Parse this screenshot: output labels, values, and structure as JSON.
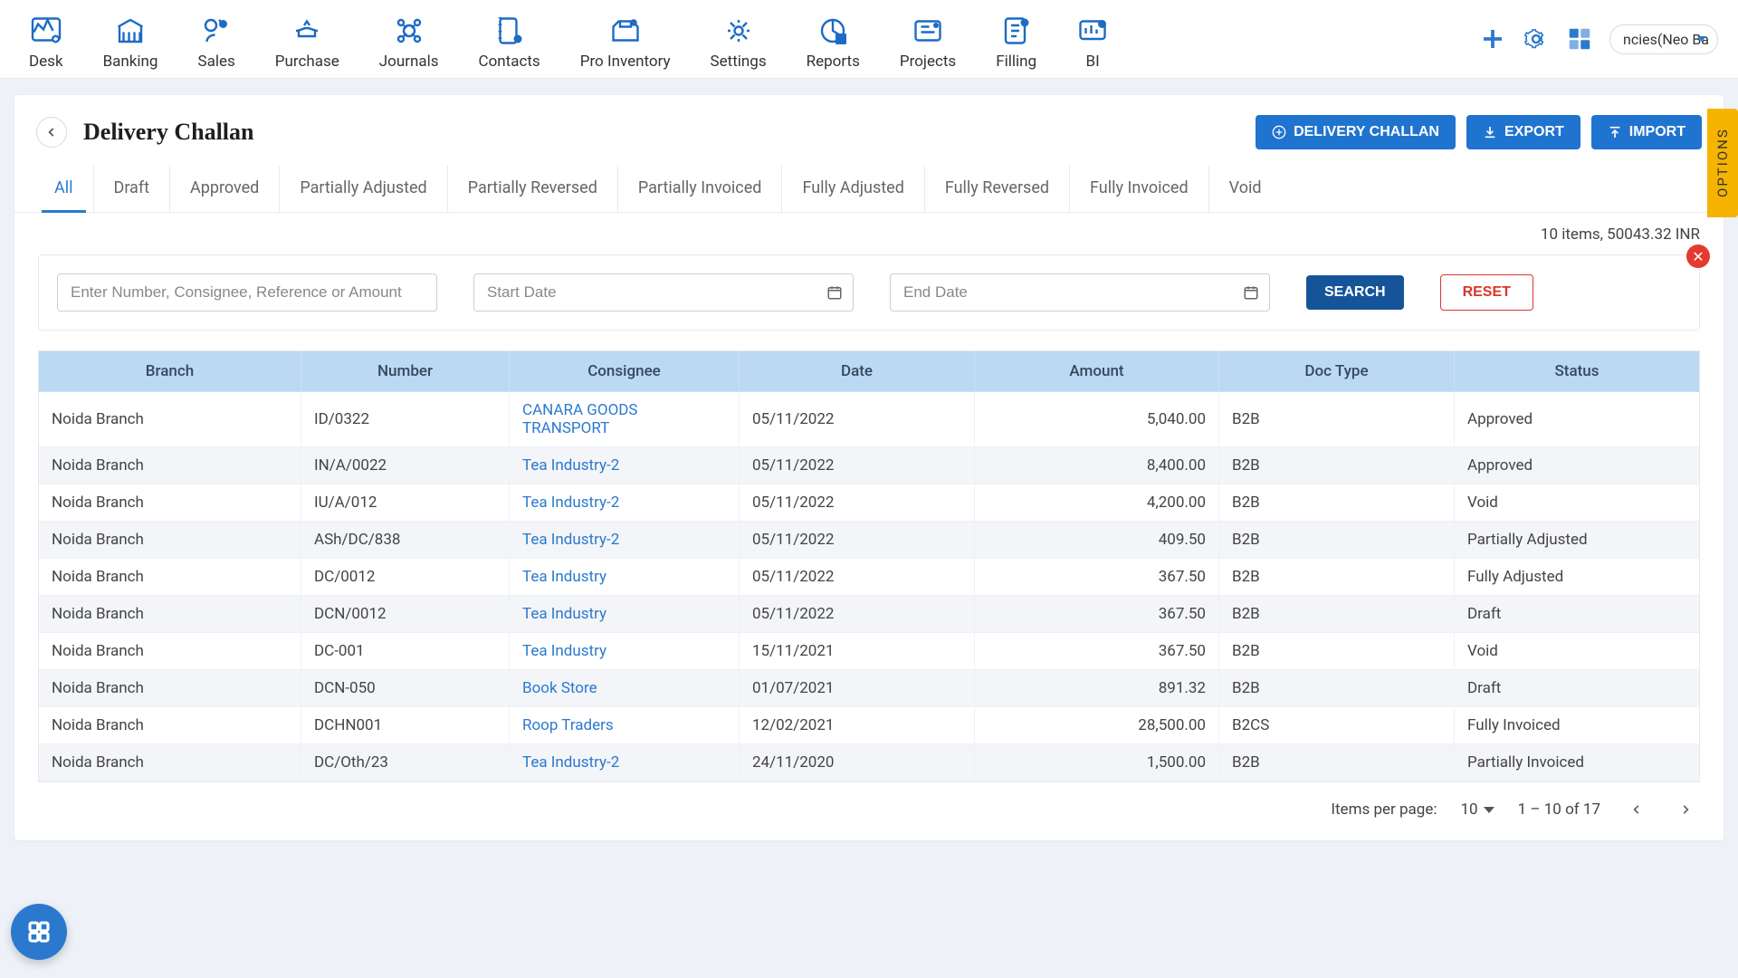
{
  "nav": {
    "items": [
      "Desk",
      "Banking",
      "Sales",
      "Purchase",
      "Journals",
      "Contacts",
      "Pro Inventory",
      "Settings",
      "Reports",
      "Projects",
      "Filling",
      "BI"
    ]
  },
  "account_label": "ncies(Neo Ba",
  "page": {
    "title": "Delivery Challan",
    "primary_button": "DELIVERY CHALLAN",
    "export_button": "EXPORT",
    "import_button": "IMPORT"
  },
  "tabs": [
    "All",
    "Draft",
    "Approved",
    "Partially Adjusted",
    "Partially Reversed",
    "Partially Invoiced",
    "Fully Adjusted",
    "Fully Reversed",
    "Fully Invoiced",
    "Void"
  ],
  "summary": "10 items, 50043.32 INR",
  "filters": {
    "search_placeholder": "Enter Number, Consignee, Reference or Amount",
    "start_placeholder": "Start Date",
    "end_placeholder": "End Date",
    "search_btn": "SEARCH",
    "reset_btn": "RESET"
  },
  "table": {
    "columns": [
      "Branch",
      "Number",
      "Consignee",
      "Date",
      "Amount",
      "Doc Type",
      "Status"
    ],
    "rows": [
      {
        "branch": "Noida Branch",
        "number": "ID/0322",
        "consignee": "CANARA GOODS TRANSPORT",
        "date": "05/11/2022",
        "amount": "5,040.00",
        "doc": "B2B",
        "status": "Approved"
      },
      {
        "branch": "Noida Branch",
        "number": "IN/A/0022",
        "consignee": "Tea Industry-2",
        "date": "05/11/2022",
        "amount": "8,400.00",
        "doc": "B2B",
        "status": "Approved"
      },
      {
        "branch": "Noida Branch",
        "number": "IU/A/012",
        "consignee": "Tea Industry-2",
        "date": "05/11/2022",
        "amount": "4,200.00",
        "doc": "B2B",
        "status": "Void"
      },
      {
        "branch": "Noida Branch",
        "number": "ASh/DC/838",
        "consignee": "Tea Industry-2",
        "date": "05/11/2022",
        "amount": "409.50",
        "doc": "B2B",
        "status": "Partially Adjusted"
      },
      {
        "branch": "Noida Branch",
        "number": "DC/0012",
        "consignee": "Tea Industry",
        "date": "05/11/2022",
        "amount": "367.50",
        "doc": "B2B",
        "status": "Fully Adjusted"
      },
      {
        "branch": "Noida Branch",
        "number": "DCN/0012",
        "consignee": "Tea Industry",
        "date": "05/11/2022",
        "amount": "367.50",
        "doc": "B2B",
        "status": "Draft"
      },
      {
        "branch": "Noida Branch",
        "number": "DC-001",
        "consignee": "Tea Industry",
        "date": "15/11/2021",
        "amount": "367.50",
        "doc": "B2B",
        "status": "Void"
      },
      {
        "branch": "Noida Branch",
        "number": "DCN-050",
        "consignee": "Book Store",
        "date": "01/07/2021",
        "amount": "891.32",
        "doc": "B2B",
        "status": "Draft"
      },
      {
        "branch": "Noida Branch",
        "number": "DCHN001",
        "consignee": "Roop Traders",
        "date": "12/02/2021",
        "amount": "28,500.00",
        "doc": "B2CS",
        "status": "Fully Invoiced"
      },
      {
        "branch": "Noida Branch",
        "number": "DC/Oth/23",
        "consignee": "Tea Industry-2",
        "date": "24/11/2020",
        "amount": "1,500.00",
        "doc": "B2B",
        "status": "Partially Invoiced"
      }
    ]
  },
  "paginator": {
    "items_label": "Items per page:",
    "page_size": "10",
    "range": "1 – 10 of 17"
  },
  "options_tab": "OPTIONS"
}
